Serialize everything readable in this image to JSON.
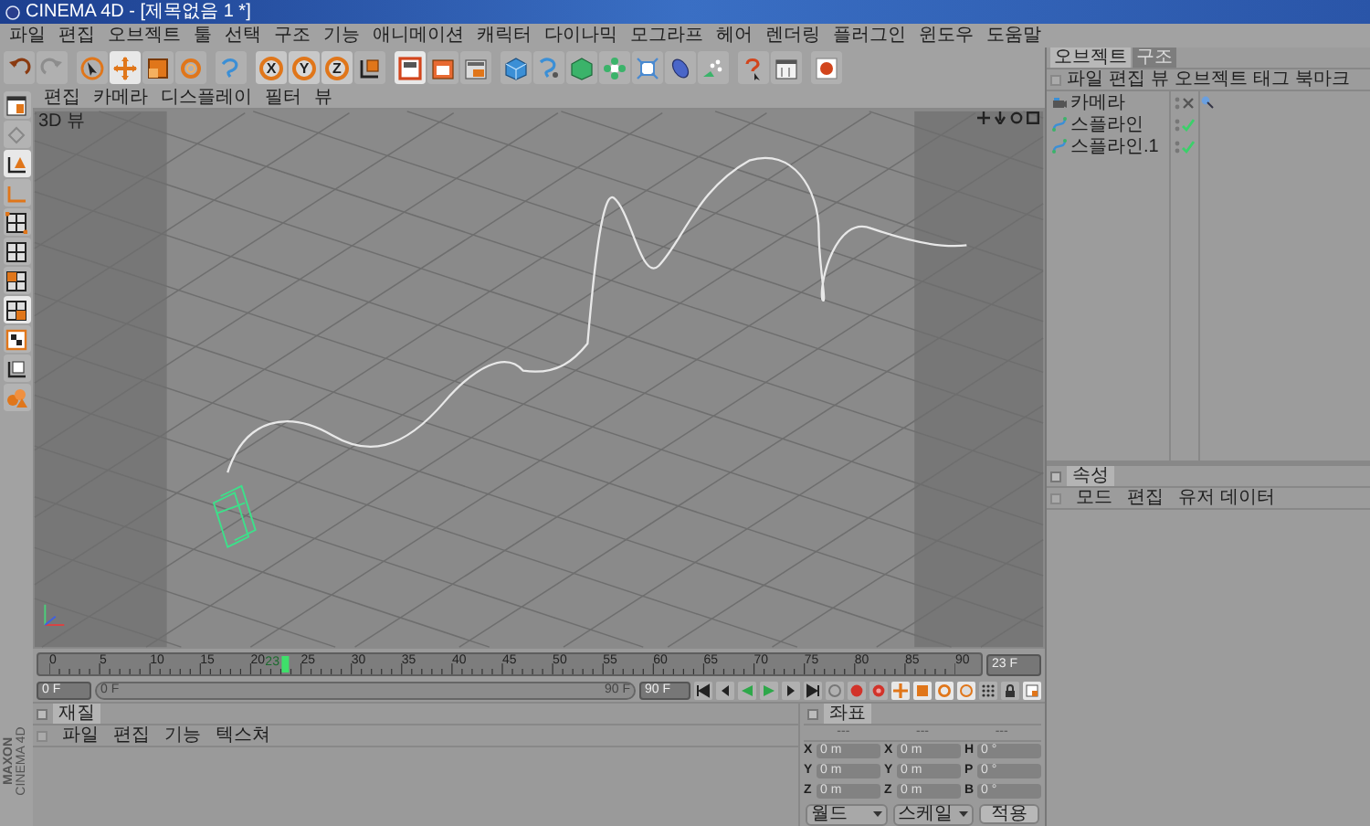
{
  "window": {
    "title": "CINEMA 4D - [제목없음 1 *]"
  },
  "menu": [
    "파일",
    "편집",
    "오브젝트",
    "툴",
    "선택",
    "구조",
    "기능",
    "애니메이션",
    "캐릭터",
    "다이나믹",
    "모그라프",
    "헤어",
    "렌더링",
    "플러그인",
    "윈도우",
    "도움말"
  ],
  "toolbar": {
    "axis_buttons": [
      "X",
      "Y",
      "Z"
    ]
  },
  "viewport": {
    "menu": [
      "편집",
      "카메라",
      "디스플레이",
      "필터",
      "뷰"
    ],
    "label": "3D 뷰"
  },
  "timeline": {
    "ticks": [
      "0",
      "5",
      "10",
      "15",
      "20",
      "25",
      "30",
      "35",
      "40",
      "45",
      "50",
      "55",
      "60",
      "65",
      "70",
      "75",
      "80",
      "85",
      "90"
    ],
    "playhead": {
      "label": "23",
      "level": 0.256
    },
    "current_frame": "23 F"
  },
  "playback": {
    "start_field": "0 F",
    "range_start": "0 F",
    "range_end": "90 F",
    "range_level": {
      "level": 1
    },
    "end_field": "90 F"
  },
  "material_manager": {
    "tab": "재질",
    "menu": [
      "파일",
      "편집",
      "기능",
      "텍스쳐"
    ]
  },
  "coordinates": {
    "tab": "좌표",
    "headers": [
      "---",
      "---",
      "---"
    ],
    "rows": [
      {
        "fields": [
          {
            "label": "X",
            "value": "0 m"
          },
          {
            "label": "X",
            "value": "0 m"
          },
          {
            "label": "H",
            "value": "0 °"
          }
        ]
      },
      {
        "fields": [
          {
            "label": "Y",
            "value": "0 m"
          },
          {
            "label": "Y",
            "value": "0 m"
          },
          {
            "label": "P",
            "value": "0 °"
          }
        ]
      },
      {
        "fields": [
          {
            "label": "Z",
            "value": "0 m"
          },
          {
            "label": "Z",
            "value": "0 m"
          },
          {
            "label": "B",
            "value": "0 °"
          }
        ]
      }
    ],
    "dropdowns": [
      "월드",
      "스케일"
    ],
    "apply_button": "적용"
  },
  "object_manager": {
    "tabs": [
      {
        "label": "오브젝트",
        "selected": true
      },
      {
        "label": "구조",
        "selected": false
      }
    ],
    "menu": [
      "파일",
      "편집",
      "뷰",
      "오브젝트",
      "태그",
      "북마크"
    ],
    "objects": [
      {
        "name": "카메라",
        "kind": "camera",
        "enabled": false
      },
      {
        "name": "스플라인",
        "kind": "spline",
        "enabled": true
      },
      {
        "name": "스플라인.1",
        "kind": "spline",
        "enabled": true
      }
    ]
  },
  "attributes": {
    "tab": "속성",
    "menu": [
      "모드",
      "편집",
      "유저 데이터"
    ]
  },
  "branding": [
    "MAXON",
    "CINEMA 4D"
  ]
}
